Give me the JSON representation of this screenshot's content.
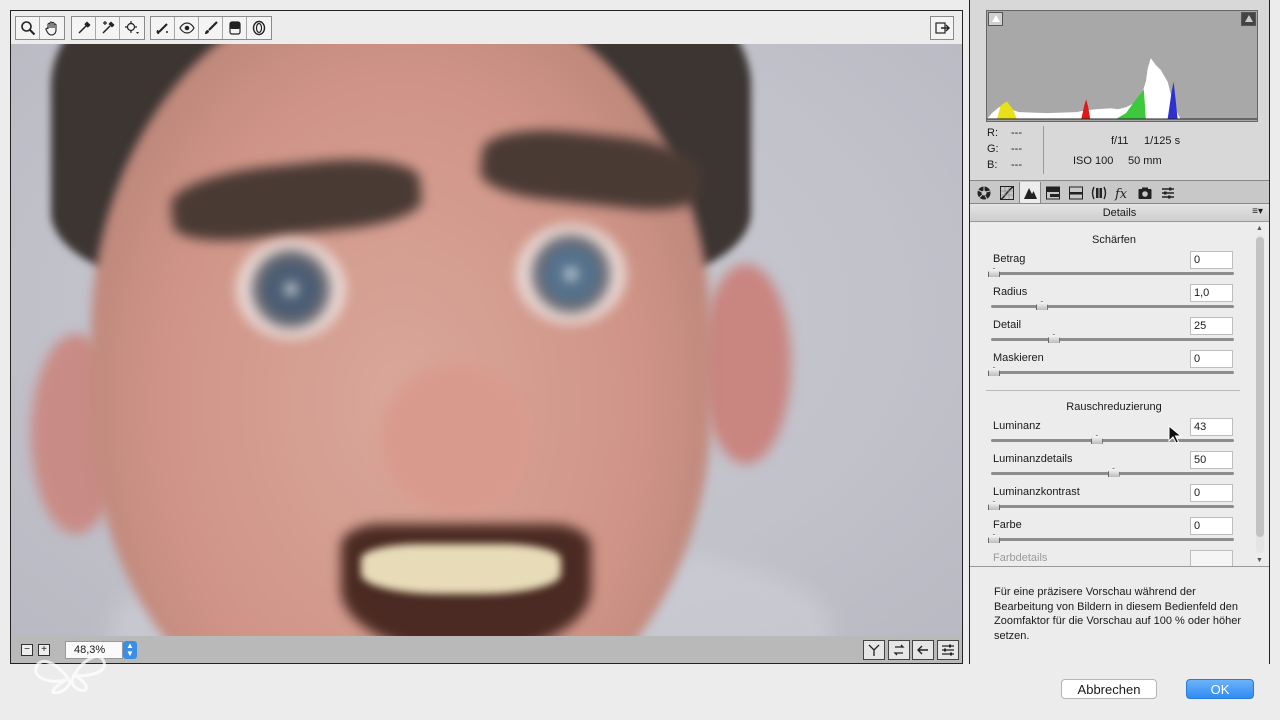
{
  "toolbar": {
    "tools": [
      {
        "name": "zoom-tool",
        "icon": "magnifier-icon"
      },
      {
        "name": "hand-tool",
        "icon": "hand-icon"
      },
      {
        "name": "white-balance-tool",
        "icon": "eyedropper-icon"
      },
      {
        "name": "color-sampler-tool",
        "icon": "eyedropper-plus-icon"
      },
      {
        "name": "targeted-adjustment-tool",
        "icon": "target-icon"
      },
      {
        "name": "spot-removal-tool",
        "icon": "spot-brush-icon"
      },
      {
        "name": "red-eye-tool",
        "icon": "eye-icon"
      },
      {
        "name": "adjustment-brush-tool",
        "icon": "brush-icon"
      },
      {
        "name": "graduated-filter-tool",
        "icon": "graduated-filter-icon"
      },
      {
        "name": "radial-filter-tool",
        "icon": "radial-filter-icon"
      }
    ],
    "open_object_icon": "export-icon"
  },
  "statusbar": {
    "zoom_value": "48,3%"
  },
  "histogram": {
    "colors": {
      "background": "#a8a8a8",
      "red": "#e01818",
      "green": "#3ec83e",
      "blue": "#3030d0",
      "yellow": "#e8e018",
      "white": "#ffffff"
    }
  },
  "info": {
    "r_label": "R:",
    "r_value": "---",
    "g_label": "G:",
    "g_value": "---",
    "b_label": "B:",
    "b_value": "---",
    "aperture": "f/11",
    "shutter": "1/125 s",
    "iso": "ISO 100",
    "focal": "50 mm"
  },
  "panel": {
    "section_title": "Details",
    "sharpen_title": "Schärfen",
    "noise_title": "Rauschreduzierung",
    "sharpen_rows": [
      {
        "label": "Betrag",
        "value": "0",
        "fraction": 0.0
      },
      {
        "label": "Radius",
        "value": "1,0",
        "fraction": 0.2
      },
      {
        "label": "Detail",
        "value": "25",
        "fraction": 0.25
      },
      {
        "label": "Maskieren",
        "value": "0",
        "fraction": 0.0
      }
    ],
    "noise_rows": [
      {
        "label": "Luminanz",
        "value": "43",
        "fraction": 0.43
      },
      {
        "label": "Luminanzdetails",
        "value": "50",
        "fraction": 0.5
      },
      {
        "label": "Luminanzkontrast",
        "value": "0",
        "fraction": 0.0
      },
      {
        "label": "Farbe",
        "value": "0",
        "fraction": 0.0
      },
      {
        "label": "Farbdetails",
        "value": ""
      }
    ],
    "hint": "Für eine präzisere Vorschau während der Bearbeitung von Bildern in diesem Bedienfeld den Zoomfaktor für die Vorschau auf 100 % oder höher setzen."
  },
  "buttons": {
    "cancel": "Abbrechen",
    "ok": "OK"
  }
}
